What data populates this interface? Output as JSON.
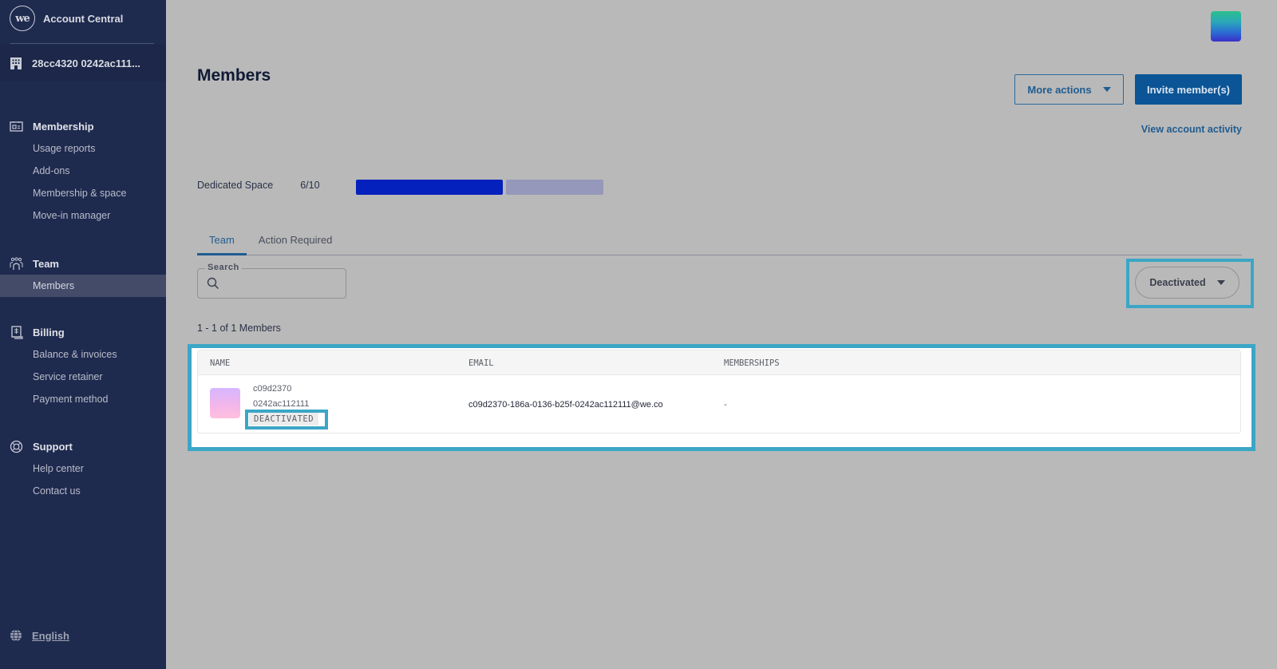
{
  "app": {
    "logo_text": "we",
    "name": "Account Central",
    "account_name": "28cc4320 0242ac111..."
  },
  "sidebar": {
    "groups": [
      {
        "label": "Membership",
        "icon": "membership-card-icon",
        "items": [
          {
            "label": "Usage reports"
          },
          {
            "label": "Add-ons"
          },
          {
            "label": "Membership & space"
          },
          {
            "label": "Move-in manager"
          }
        ]
      },
      {
        "label": "Team",
        "icon": "team-icon",
        "items": [
          {
            "label": "Members",
            "active": true
          }
        ]
      },
      {
        "label": "Billing",
        "icon": "receipt-icon",
        "items": [
          {
            "label": "Balance & invoices"
          },
          {
            "label": "Service retainer"
          },
          {
            "label": "Payment method"
          }
        ]
      },
      {
        "label": "Support",
        "icon": "lifebuoy-icon",
        "items": [
          {
            "label": "Help center"
          },
          {
            "label": "Contact us"
          }
        ]
      }
    ],
    "language": "English"
  },
  "header": {
    "title": "Members",
    "more_actions_label": "More actions",
    "invite_label": "Invite member(s)",
    "view_activity_label": "View account activity"
  },
  "capacity": {
    "label": "Dedicated Space",
    "value_text": "6/10",
    "used": 6,
    "total": 10
  },
  "tabs": [
    {
      "label": "Team",
      "active": true
    },
    {
      "label": "Action Required",
      "active": false
    }
  ],
  "search": {
    "label": "Search",
    "value": "",
    "placeholder": ""
  },
  "filter": {
    "selected": "Deactivated"
  },
  "results_count": "1 - 1 of 1 Members",
  "table": {
    "columns": [
      "NAME",
      "EMAIL",
      "MEMBERSHIPS"
    ],
    "rows": [
      {
        "name_line1": "c09d2370",
        "name_line2": "0242ac112111",
        "status": "DEACTIVATED",
        "email": "c09d2370-186a-0136-b25f-0242ac112111@we.co",
        "memberships": "-"
      }
    ]
  },
  "colors": {
    "sidebar_bg": "#1f2a4f",
    "primary": "#0b5596",
    "capacity_filled": "#0420bd",
    "capacity_empty": "#9597bb",
    "highlight": "#3ba6c6"
  }
}
